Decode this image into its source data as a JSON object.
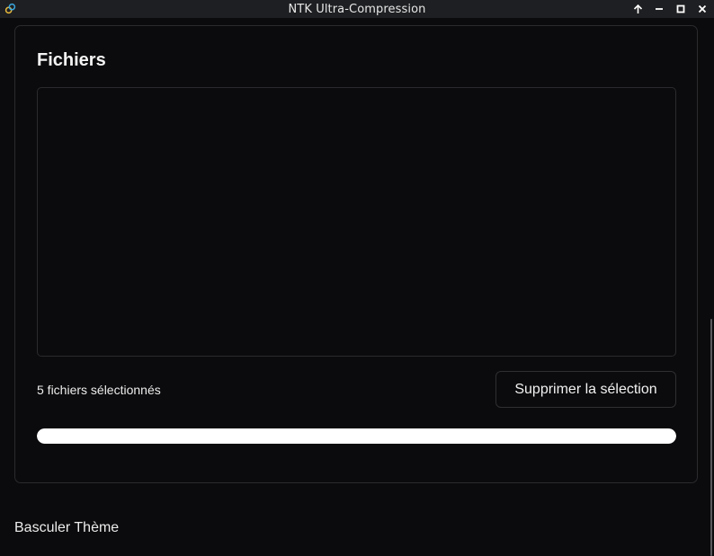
{
  "window": {
    "title": "NTK Ultra-Compression",
    "icon": "link-icon",
    "controls": [
      "keep-above-icon",
      "minimize-icon",
      "maximize-icon",
      "close-icon"
    ]
  },
  "files_panel": {
    "title": "Fichiers",
    "selected_count_text": "5 fichiers sélectionnés",
    "clear_button_label": "Supprimer la sélection",
    "progress": 1.0
  },
  "theme_toggle_label": "Basculer Thème",
  "colors": {
    "background": "#0b0b0d",
    "border": "#2b2b2f",
    "progress_fill": "#ffffff",
    "text": "#f2f2f2"
  }
}
